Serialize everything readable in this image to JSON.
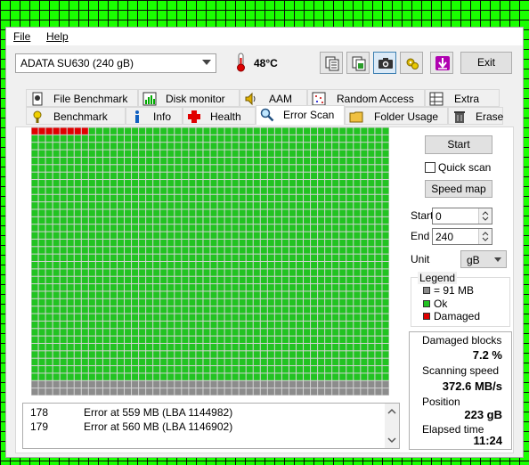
{
  "menu": {
    "file": "File",
    "help": "Help"
  },
  "drive": {
    "selected": "ADATA SU630 (240 gB)"
  },
  "temperature": "48°C",
  "toolbar": {
    "icons": [
      "copy-text-icon",
      "copy-image-icon",
      "screenshot-camera-icon",
      "options-gear-icon",
      "save-down-arrow-icon"
    ],
    "exit_label": "Exit"
  },
  "tabs_top": [
    {
      "label": "File Benchmark",
      "icon": "file-benchmark-icon"
    },
    {
      "label": "Disk monitor",
      "icon": "disk-monitor-icon"
    },
    {
      "label": "AAM",
      "icon": "speaker-icon"
    },
    {
      "label": "Random Access",
      "icon": "random-access-icon"
    },
    {
      "label": "Extra tests",
      "icon": "extra-tests-icon"
    }
  ],
  "tabs_bottom": [
    {
      "label": "Benchmark",
      "icon": "benchmark-icon"
    },
    {
      "label": "Info",
      "icon": "info-icon"
    },
    {
      "label": "Health",
      "icon": "health-cross-icon"
    },
    {
      "label": "Error Scan",
      "icon": "magnifier-icon"
    },
    {
      "label": "Folder Usage",
      "icon": "folder-icon"
    },
    {
      "label": "Erase",
      "icon": "trash-icon"
    }
  ],
  "active_tab": "Error Scan",
  "scan_map": {
    "columns": 50,
    "rows": 36,
    "damaged_blocks_count": 8,
    "scanned_rows": 34,
    "colors": {
      "ok": "#22c322",
      "damaged": "#e00000",
      "unscanned": "#8c8c8c",
      "gridline": "#d4d4d4"
    }
  },
  "log": [
    {
      "num": "178",
      "msg": "Error at 559 MB (LBA 1144982)"
    },
    {
      "num": "179",
      "msg": "Error at 560 MB (LBA 1146902)"
    }
  ],
  "controls": {
    "start_button": "Start",
    "quick_scan_label": "Quick scan",
    "quick_scan_checked": false,
    "speed_map_button": "Speed map",
    "start_label": "Start",
    "start_value": "0",
    "end_label": "End",
    "end_value": "240",
    "unit_label": "Unit",
    "unit_value": "gB"
  },
  "legend": {
    "title": "Legend",
    "items": [
      {
        "label": "= 91 MB",
        "color": "#8c8c8c"
      },
      {
        "label": "Ok",
        "color": "#22c322"
      },
      {
        "label": "Damaged",
        "color": "#e00000"
      }
    ]
  },
  "stats": {
    "damaged_label": "Damaged blocks",
    "damaged_value": "7.2 %",
    "speed_label": "Scanning speed",
    "speed_value": "372.6 MB/s",
    "position_label": "Position",
    "position_value": "223 gB",
    "elapsed_label": "Elapsed time",
    "elapsed_value": "11:24"
  }
}
